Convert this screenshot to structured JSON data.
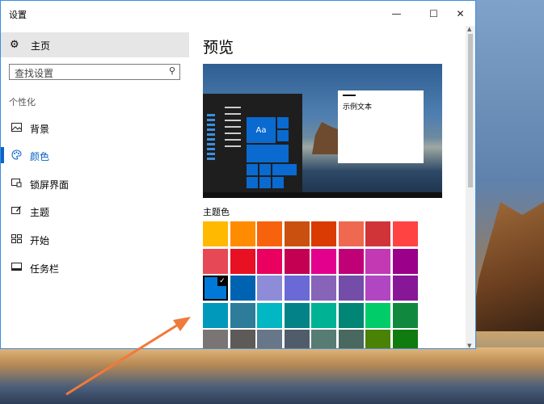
{
  "window": {
    "title": "设置",
    "controls": {
      "minimize": "—",
      "maximize": "☐",
      "close": "✕"
    }
  },
  "sidebar": {
    "home": {
      "icon": "gear-icon",
      "label": "主页"
    },
    "search": {
      "placeholder": "查找设置",
      "icon": "search-icon"
    },
    "section_label": "个性化",
    "items": [
      {
        "label": "背景",
        "icon": "picture-icon",
        "active": false
      },
      {
        "label": "颜色",
        "icon": "palette-icon",
        "active": true
      },
      {
        "label": "锁屏界面",
        "icon": "lockscreen-icon",
        "active": false
      },
      {
        "label": "主题",
        "icon": "theme-icon",
        "active": false
      },
      {
        "label": "开始",
        "icon": "start-icon",
        "active": false
      },
      {
        "label": "任务栏",
        "icon": "taskbar-icon",
        "active": false
      }
    ]
  },
  "main": {
    "heading": "预览",
    "preview": {
      "sample_text": "示例文本",
      "tile_text": "Aa"
    },
    "theme_color_label": "主题色",
    "accent_selected": "#0a6ad0",
    "swatch_rows": [
      [
        "#ffb900",
        "#ff8c00",
        "#f7630c",
        "#ca5010",
        "#da3b01",
        "#ef6950",
        "#d13438",
        "#ff4343"
      ],
      [
        "#e74856",
        "#e81123",
        "#ea005e",
        "#c30052",
        "#e3008c",
        "#bf0077",
        "#c239b3",
        "#9a0089"
      ],
      [
        "#0078d7",
        "#0063b1",
        "#8e8cd8",
        "#6b69d6",
        "#8764b8",
        "#744da9",
        "#b146c2",
        "#881798"
      ],
      [
        "#0099bc",
        "#2d7d9a",
        "#00b7c3",
        "#038387",
        "#00b294",
        "#018574",
        "#00cc6a",
        "#10893e"
      ],
      [
        "#7a7574",
        "#5d5a58",
        "#68768a",
        "#515c6b",
        "#567c73",
        "#486860",
        "#498205",
        "#107c10"
      ]
    ]
  }
}
